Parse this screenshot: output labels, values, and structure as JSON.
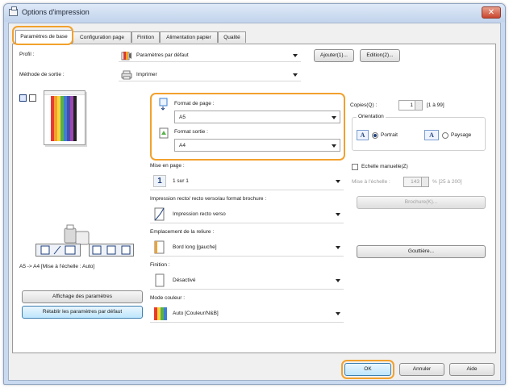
{
  "window": {
    "title": "Options d'impression",
    "close_label": "✕"
  },
  "tabs": [
    {
      "label": "Paramètres de base"
    },
    {
      "label": "Configuration page"
    },
    {
      "label": "Finition"
    },
    {
      "label": "Alimentation papier"
    },
    {
      "label": "Qualité"
    }
  ],
  "profile": {
    "label": "Profil :",
    "value": "Paramètres par défaut",
    "add_button": "Ajouter(1)...",
    "edit_button": "Edition(2)..."
  },
  "output_method": {
    "label": "Méthode de sortie :",
    "value": "Imprimer"
  },
  "paper": {
    "page_size_label": "Format de page :",
    "page_size_value": "A5",
    "output_size_label": "Format sortie :",
    "output_size_value": "A4"
  },
  "copies": {
    "label": "Copies(Q) :",
    "value": "1",
    "range": "[1 à 99]"
  },
  "orientation": {
    "label": "Orientation",
    "portrait": "Portrait",
    "landscape": "Paysage",
    "selected": "Portrait",
    "icon_letter": "A"
  },
  "manual_scale": {
    "label": "Echelle manuelle(Z)",
    "scale_label": "Mise à l'échelle :",
    "value": "143",
    "range": "% [25 à 200]"
  },
  "layout": {
    "label": "Mise en page :",
    "value": "1 sur 1",
    "badge": "1"
  },
  "duplex": {
    "label": "Impression recto/ recto verso/au format brochure :",
    "value": "Impression recto verso",
    "booklet_button": "Brochure(K)..."
  },
  "binding": {
    "label": "Emplacement de la reliure :",
    "value": "Bord long [gauche]",
    "gutter_button": "Gouttière..."
  },
  "finishing": {
    "label": "Finition :",
    "value": "Désactivé"
  },
  "color_mode": {
    "label": "Mode couleur :",
    "value": "Auto [Couleur/N&B]"
  },
  "preview": {
    "caption": "A5 -> A4 [Mise à l'échelle : Auto]"
  },
  "left_buttons": {
    "show_settings": "Affichage des paramètres",
    "restore_defaults": "Rétablir les paramètres par défaut"
  },
  "footer": {
    "ok": "OK",
    "cancel": "Annuler",
    "help": "Aide"
  },
  "colors": {
    "highlight": "#f2a12d",
    "title_bar": "#c9d9ef",
    "accent": "#1f3f7a"
  }
}
